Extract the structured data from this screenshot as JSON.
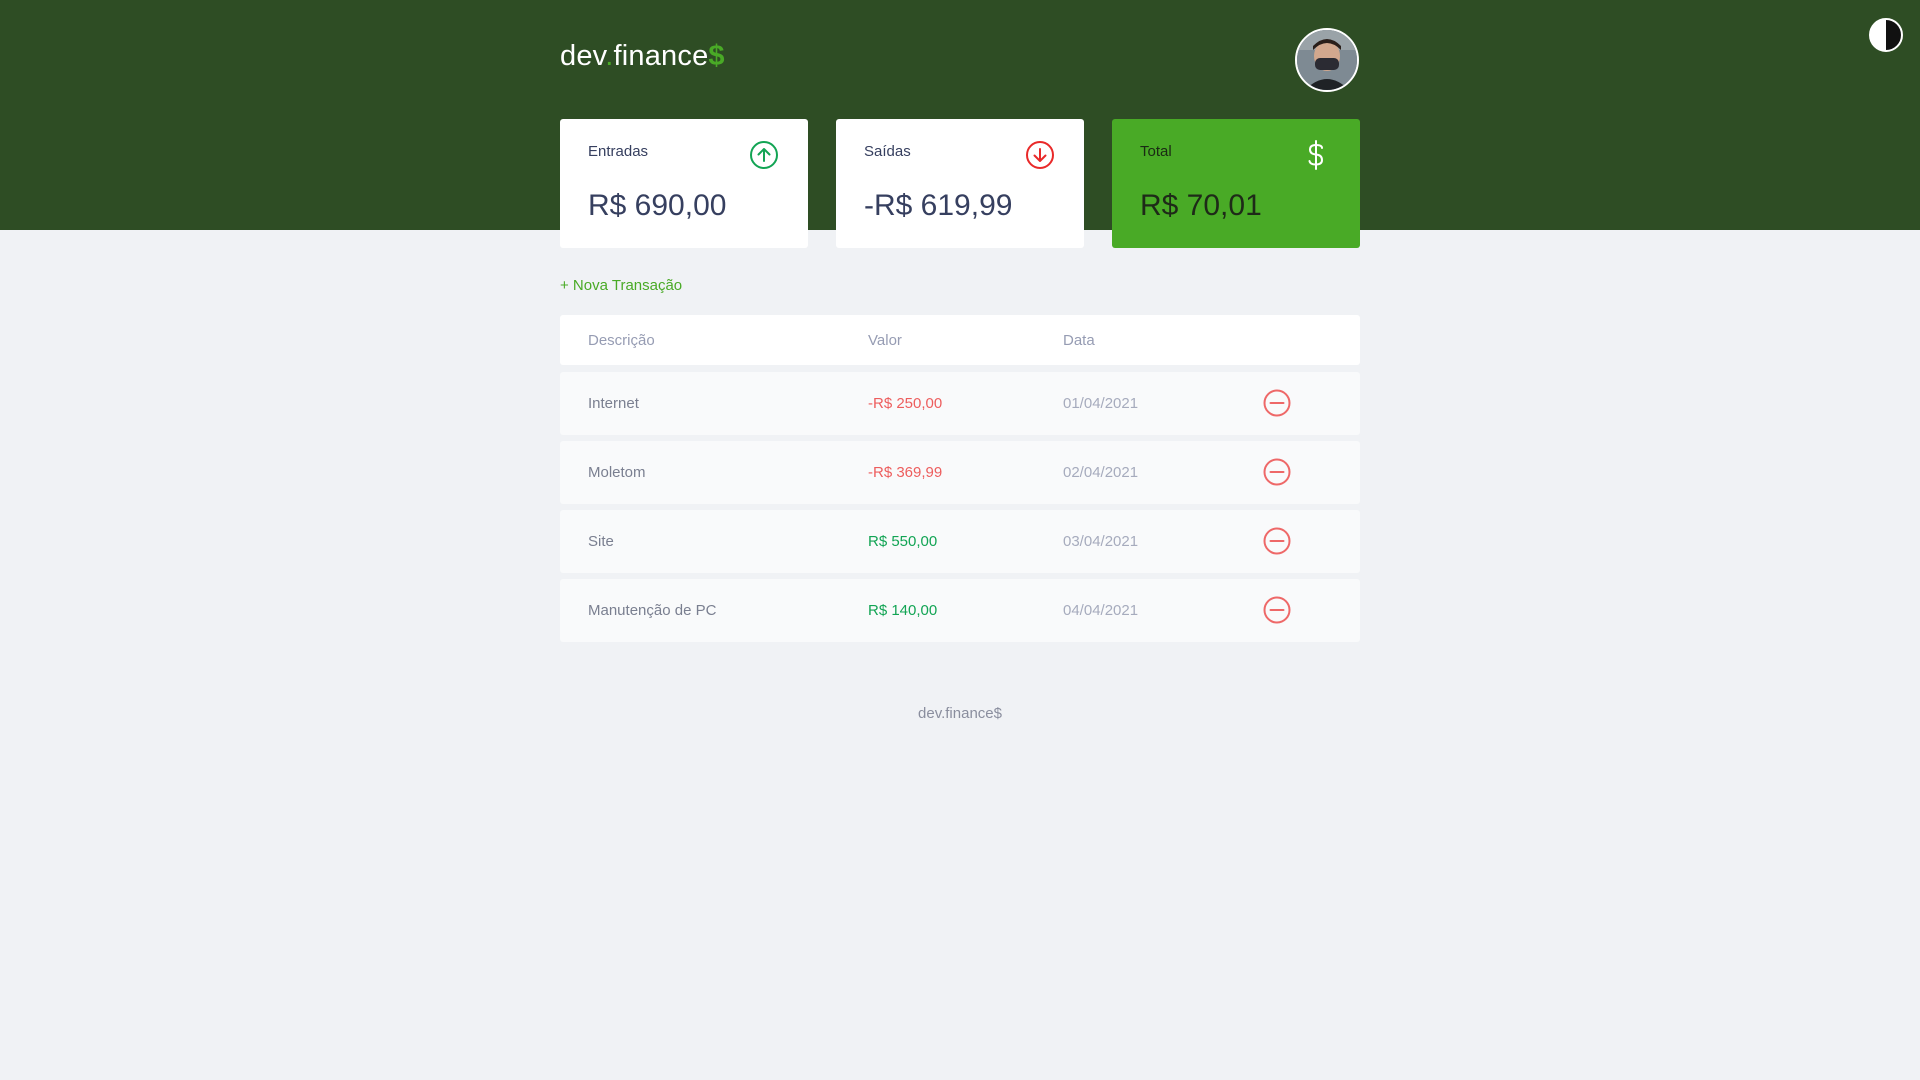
{
  "header": {
    "logo_main": "dev",
    "logo_dot": ".",
    "logo_rest": "finance",
    "logo_symbol": "$",
    "avatar_icon": "user-avatar",
    "theme_toggle_icon": "contrast-icon"
  },
  "cards": {
    "income": {
      "title": "Entradas",
      "value": "R$ 690,00",
      "icon": "arrow-up-circle-icon"
    },
    "expense": {
      "title": "Saídas",
      "value": "-R$ 619,99",
      "icon": "arrow-down-circle-icon"
    },
    "total": {
      "title": "Total",
      "value": "R$ 70,01",
      "icon": "dollar-icon"
    }
  },
  "new_transaction_label": "+ Nova Transação",
  "table": {
    "headers": {
      "description": "Descrição",
      "value": "Valor",
      "date": "Data"
    },
    "rows": [
      {
        "description": "Internet",
        "value": "-R$ 250,00",
        "date": "01/04/2021",
        "type": "expense"
      },
      {
        "description": "Moletom",
        "value": "-R$ 369,99",
        "date": "02/04/2021",
        "type": "expense"
      },
      {
        "description": "Site",
        "value": "R$ 550,00",
        "date": "03/04/2021",
        "type": "income"
      },
      {
        "description": "Manutenção de PC",
        "value": "R$ 140,00",
        "date": "04/04/2021",
        "type": "income"
      }
    ]
  },
  "footer": "dev.finance$",
  "colors": {
    "header_bg": "#2e4d24",
    "accent_green": "#49aa26",
    "income_green": "#12a454",
    "expense_red": "#e92929",
    "background": "#f0f2f5"
  }
}
